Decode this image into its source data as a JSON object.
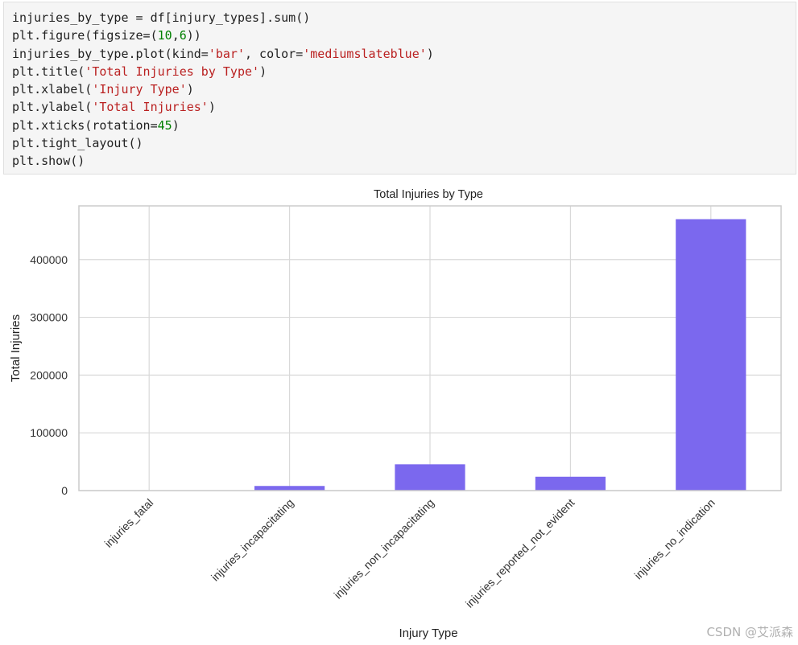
{
  "code_cell": {
    "lines": [
      [
        {
          "t": "injuries_by_type = df[injury_types].sum()",
          "c": ""
        }
      ],
      [
        {
          "t": "plt.figure(figsize=(",
          "c": ""
        },
        {
          "t": "10",
          "c": "num"
        },
        {
          "t": ",",
          "c": ""
        },
        {
          "t": "6",
          "c": "num"
        },
        {
          "t": "))",
          "c": ""
        }
      ],
      [
        {
          "t": "injuries_by_type.plot(kind=",
          "c": ""
        },
        {
          "t": "'bar'",
          "c": "str"
        },
        {
          "t": ", color=",
          "c": ""
        },
        {
          "t": "'mediumslateblue'",
          "c": "str"
        },
        {
          "t": ")",
          "c": ""
        }
      ],
      [
        {
          "t": "plt.title(",
          "c": ""
        },
        {
          "t": "'Total Injuries by Type'",
          "c": "str"
        },
        {
          "t": ")",
          "c": ""
        }
      ],
      [
        {
          "t": "plt.xlabel(",
          "c": ""
        },
        {
          "t": "'Injury Type'",
          "c": "str"
        },
        {
          "t": ")",
          "c": ""
        }
      ],
      [
        {
          "t": "plt.ylabel(",
          "c": ""
        },
        {
          "t": "'Total Injuries'",
          "c": "str"
        },
        {
          "t": ")",
          "c": ""
        }
      ],
      [
        {
          "t": "plt.xticks(rotation=",
          "c": ""
        },
        {
          "t": "45",
          "c": "num"
        },
        {
          "t": ")",
          "c": ""
        }
      ],
      [
        {
          "t": "plt.tight_layout()",
          "c": ""
        }
      ],
      [
        {
          "t": "plt.show()",
          "c": ""
        }
      ]
    ]
  },
  "chart_data": {
    "type": "bar",
    "title": "Total Injuries by Type",
    "xlabel": "Injury Type",
    "ylabel": "Total Injuries",
    "categories": [
      "injuries_fatal",
      "injuries_incapacitating",
      "injuries_non_incapacitating",
      "injuries_reported_not_evident",
      "injuries_no_indication"
    ],
    "values": [
      600,
      8000,
      45500,
      24000,
      470000
    ],
    "ylim": [
      0,
      493000
    ],
    "yticks": [
      0,
      100000,
      200000,
      300000,
      400000
    ],
    "ytick_labels": [
      "0",
      "100000",
      "200000",
      "300000",
      "400000"
    ],
    "color": "#7b68ee",
    "grid": true,
    "legend": "none"
  },
  "watermark": "CSDN @艾派森"
}
